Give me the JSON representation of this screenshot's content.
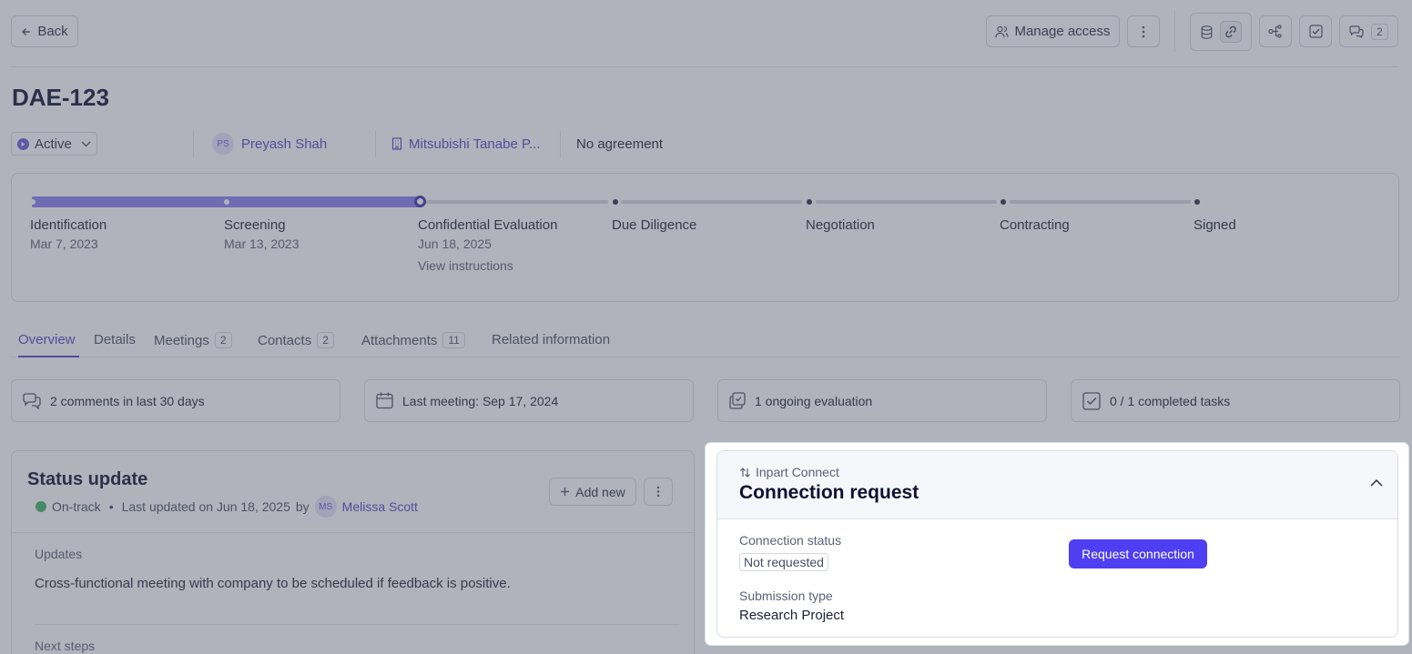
{
  "header": {
    "back_label": "Back",
    "manage_access_label": "Manage access",
    "comments_count": "2"
  },
  "deal": {
    "title": "DAE-123",
    "status": "Active",
    "owner_initials": "PS",
    "owner_name": "Preyash Shah",
    "company": "Mitsubishi Tanabe P...",
    "agreement": "No agreement"
  },
  "stages": [
    {
      "name": "Identification",
      "date": "Mar 7, 2023"
    },
    {
      "name": "Screening",
      "date": "Mar 13, 2023"
    },
    {
      "name": "Confidential Evaluation",
      "date": "Jun 18, 2025",
      "instructions": "View instructions"
    },
    {
      "name": "Due Diligence"
    },
    {
      "name": "Negotiation"
    },
    {
      "name": "Contracting"
    },
    {
      "name": "Signed"
    }
  ],
  "tabs": [
    {
      "label": "Overview"
    },
    {
      "label": "Details"
    },
    {
      "label": "Meetings",
      "count": "2"
    },
    {
      "label": "Contacts",
      "count": "2"
    },
    {
      "label": "Attachments",
      "count": "11"
    },
    {
      "label": "Related information"
    }
  ],
  "summary": {
    "comments": "2 comments in last 30 days",
    "meeting": "Last meeting: Sep 17, 2024",
    "evaluation": "1 ongoing evaluation",
    "tasks": "0 / 1 completed tasks"
  },
  "status_update": {
    "title": "Status update",
    "add_label": "Add new",
    "state": "On-track",
    "separator": "•",
    "updated": "Last updated on Jun 18, 2025",
    "by": "by",
    "author_initials": "MS",
    "author": "Melissa Scott",
    "updates_label": "Updates",
    "updates_text": "Cross-functional meeting with company to be scheduled if feedback is positive.",
    "next_steps_label": "Next steps"
  },
  "connection": {
    "kicker": "Inpart Connect",
    "title": "Connection request",
    "status_label": "Connection status",
    "status_value": "Not requested",
    "button_label": "Request connection",
    "submission_label": "Submission type",
    "submission_value": "Research Project"
  }
}
